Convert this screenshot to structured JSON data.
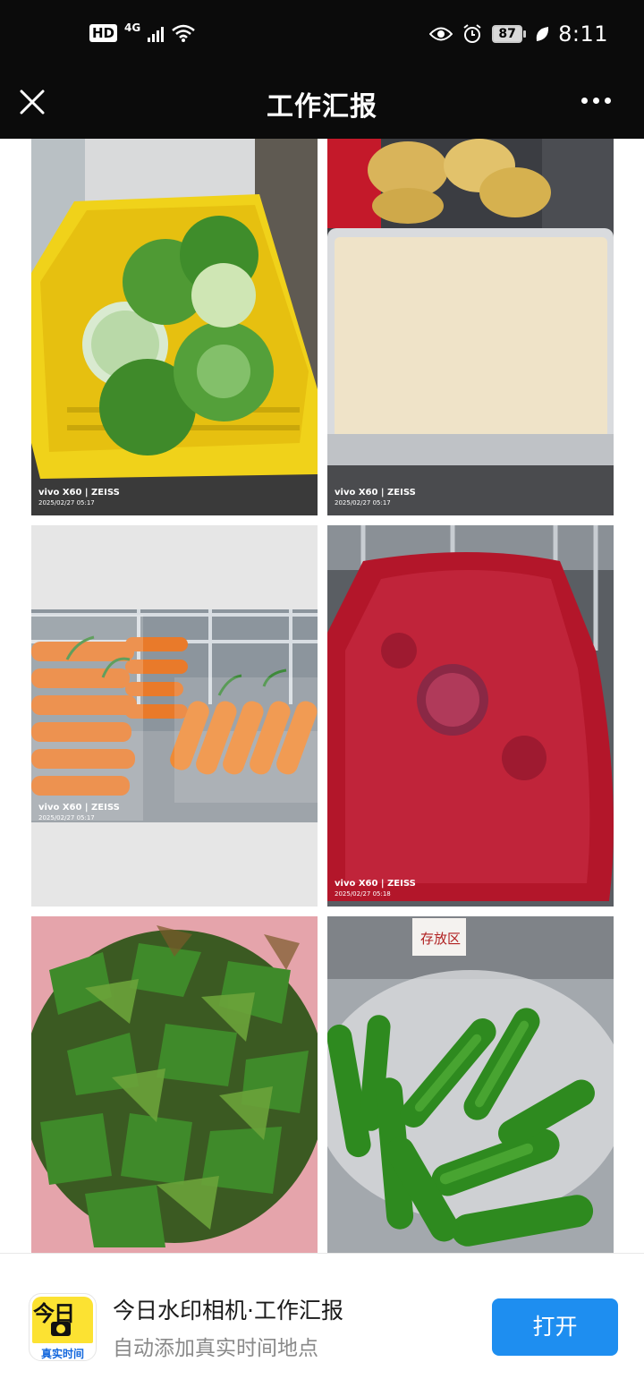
{
  "status_bar": {
    "hd_badge": "HD",
    "network": "4G",
    "battery_level": "87",
    "time": "8:11"
  },
  "nav": {
    "title": "工作汇报"
  },
  "photos": [
    {
      "subject": "cabbages in yellow crate",
      "watermark_brand": "vivo X60 | ZEISS",
      "watermark_date": "2025/02/27 05:17"
    },
    {
      "subject": "dough tray",
      "watermark_brand": "vivo X60 | ZEISS",
      "watermark_date": "2025/02/27 05:17"
    },
    {
      "subject": "bagged carrots",
      "watermark_brand": "vivo X60 | ZEISS",
      "watermark_date": "2025/02/27 05:17"
    },
    {
      "subject": "onions in red mesh bag",
      "watermark_brand": "vivo X60 | ZEISS",
      "watermark_date": "2025/02/27 05:18"
    },
    {
      "subject": "kelp in pink bag",
      "sign_text": ""
    },
    {
      "subject": "green peppers",
      "sign_text": "存放区"
    }
  ],
  "footer": {
    "app_icon_top": "今日",
    "app_icon_bottom": "真实时间",
    "title": "今日水印相机·工作汇报",
    "subtitle": "自动添加真实时间地点",
    "open_button": "打开"
  },
  "colors": {
    "bar_background": "#0b0b0b",
    "button_blue": "#1e8ef0",
    "icon_yellow": "#fce232"
  }
}
